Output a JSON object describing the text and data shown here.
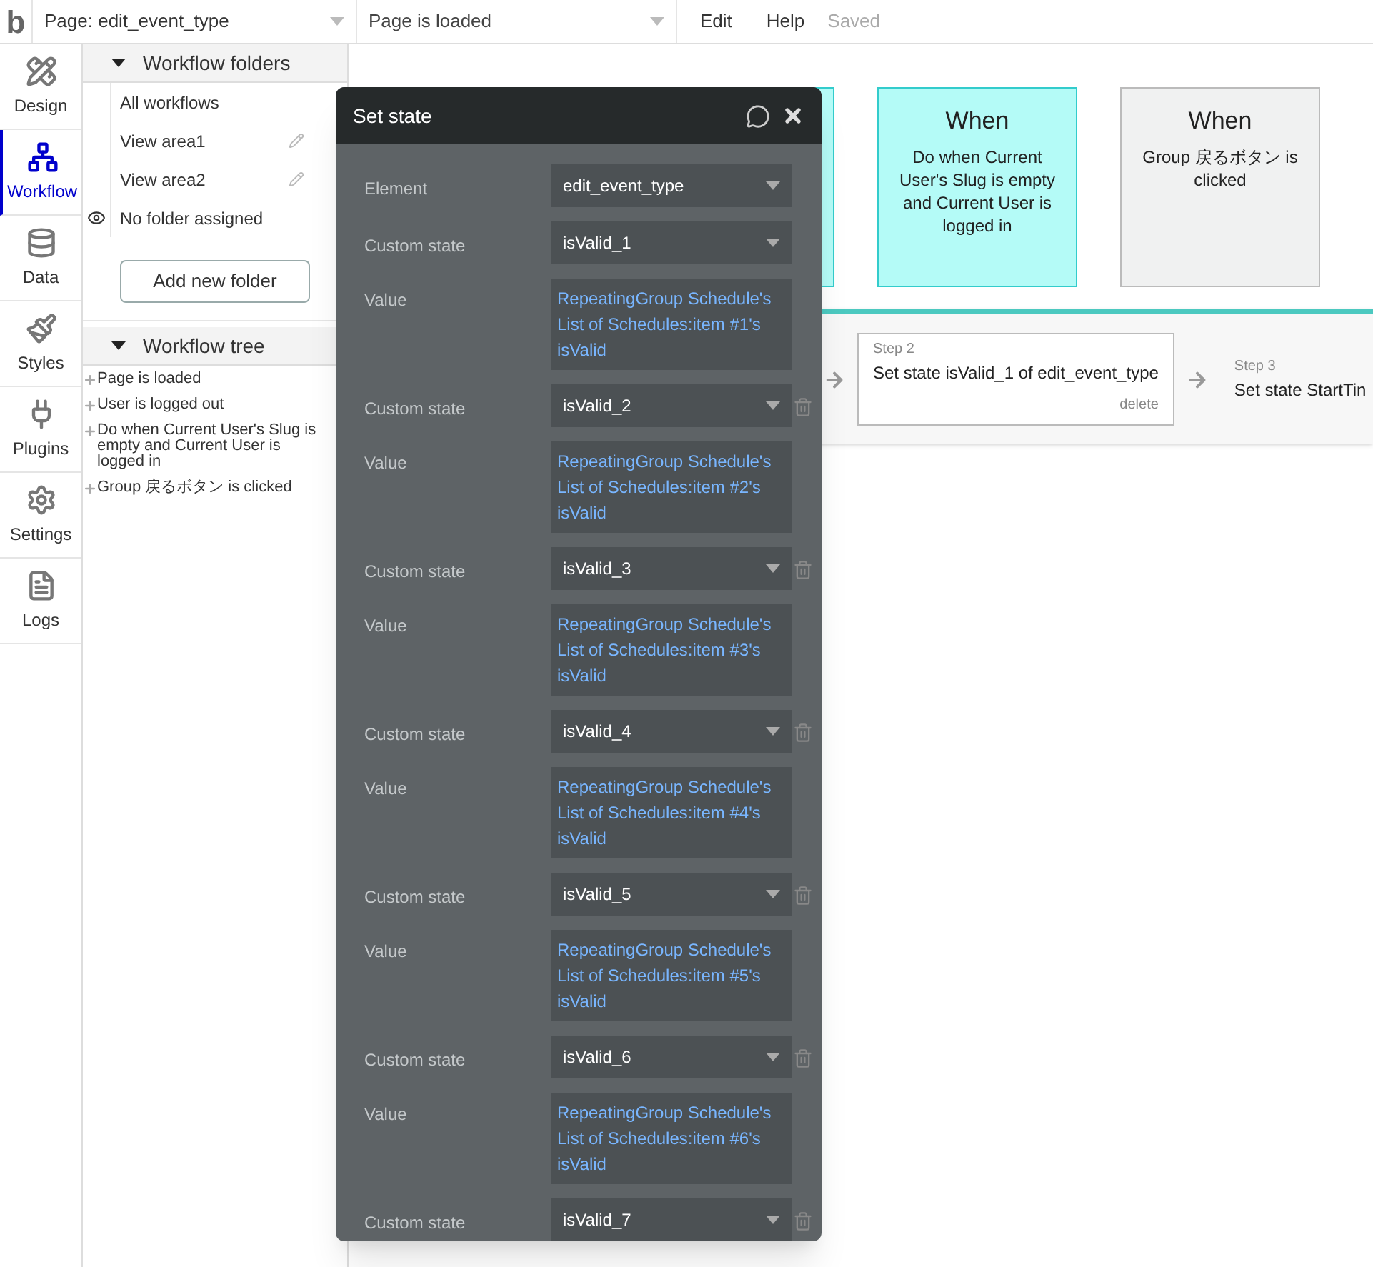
{
  "topbar": {
    "logo": "b",
    "page_selector": "Page: edit_event_type",
    "event_selector": "Page is loaded",
    "menu": [
      "Edit",
      "Help"
    ],
    "status": "Saved"
  },
  "sidebar": {
    "items": [
      {
        "label": "Design",
        "selected": false
      },
      {
        "label": "Workflow",
        "selected": true
      },
      {
        "label": "Data",
        "selected": false
      },
      {
        "label": "Styles",
        "selected": false
      },
      {
        "label": "Plugins",
        "selected": false
      },
      {
        "label": "Settings",
        "selected": false
      },
      {
        "label": "Logs",
        "selected": false
      }
    ]
  },
  "folders": {
    "title": "Workflow folders",
    "expanded": true,
    "items": [
      {
        "label": "All workflows",
        "editable": false,
        "visible_marker": false
      },
      {
        "label": "View area1",
        "editable": true,
        "visible_marker": false
      },
      {
        "label": "View area2",
        "editable": true,
        "visible_marker": false
      },
      {
        "label": "No folder assigned",
        "editable": false,
        "visible_marker": true
      }
    ],
    "add_button": "Add new folder"
  },
  "tree": {
    "title": "Workflow tree",
    "expanded": true,
    "items": [
      "Page is loaded",
      "User is logged out",
      "Do when Current User's Slug is empty and Current User is logged in",
      "Group 戻るボタン is clicked"
    ]
  },
  "canvas": {
    "events": [
      {
        "title": "When",
        "text": "Do when Current User's Slug is empty and Current User is logged in",
        "selected": true
      },
      {
        "title": "When",
        "text": "Group 戻るボタン is clicked",
        "selected": false
      }
    ],
    "steps": [
      {
        "label": "Step 2",
        "text": "Set state isValid_1 of edit_event_type",
        "delete": "delete"
      },
      {
        "label": "Step 3",
        "text": "Set state StartTin"
      }
    ]
  },
  "dialog": {
    "title": "Set state",
    "fields": [
      {
        "kind": "dropdown",
        "label": "Element",
        "value": "edit_event_type",
        "deletable": false
      },
      {
        "kind": "dropdown",
        "label": "Custom state",
        "value": "isValid_1",
        "deletable": false
      },
      {
        "kind": "value",
        "label": "Value",
        "value": "RepeatingGroup Schedule's List of Schedules:item #1's isValid"
      },
      {
        "kind": "dropdown",
        "label": "Custom state",
        "value": "isValid_2",
        "deletable": true
      },
      {
        "kind": "value",
        "label": "Value",
        "value": "RepeatingGroup Schedule's List of Schedules:item #2's isValid"
      },
      {
        "kind": "dropdown",
        "label": "Custom state",
        "value": "isValid_3",
        "deletable": true
      },
      {
        "kind": "value",
        "label": "Value",
        "value": "RepeatingGroup Schedule's List of Schedules:item #3's isValid"
      },
      {
        "kind": "dropdown",
        "label": "Custom state",
        "value": "isValid_4",
        "deletable": true
      },
      {
        "kind": "value",
        "label": "Value",
        "value": "RepeatingGroup Schedule's List of Schedules:item #4's isValid"
      },
      {
        "kind": "dropdown",
        "label": "Custom state",
        "value": "isValid_5",
        "deletable": true
      },
      {
        "kind": "value",
        "label": "Value",
        "value": "RepeatingGroup Schedule's List of Schedules:item #5's isValid"
      },
      {
        "kind": "dropdown",
        "label": "Custom state",
        "value": "isValid_6",
        "deletable": true
      },
      {
        "kind": "value",
        "label": "Value",
        "value": "RepeatingGroup Schedule's List of Schedules:item #6's isValid"
      },
      {
        "kind": "dropdown",
        "label": "Custom state",
        "value": "isValid_7",
        "deletable": true
      }
    ]
  }
}
